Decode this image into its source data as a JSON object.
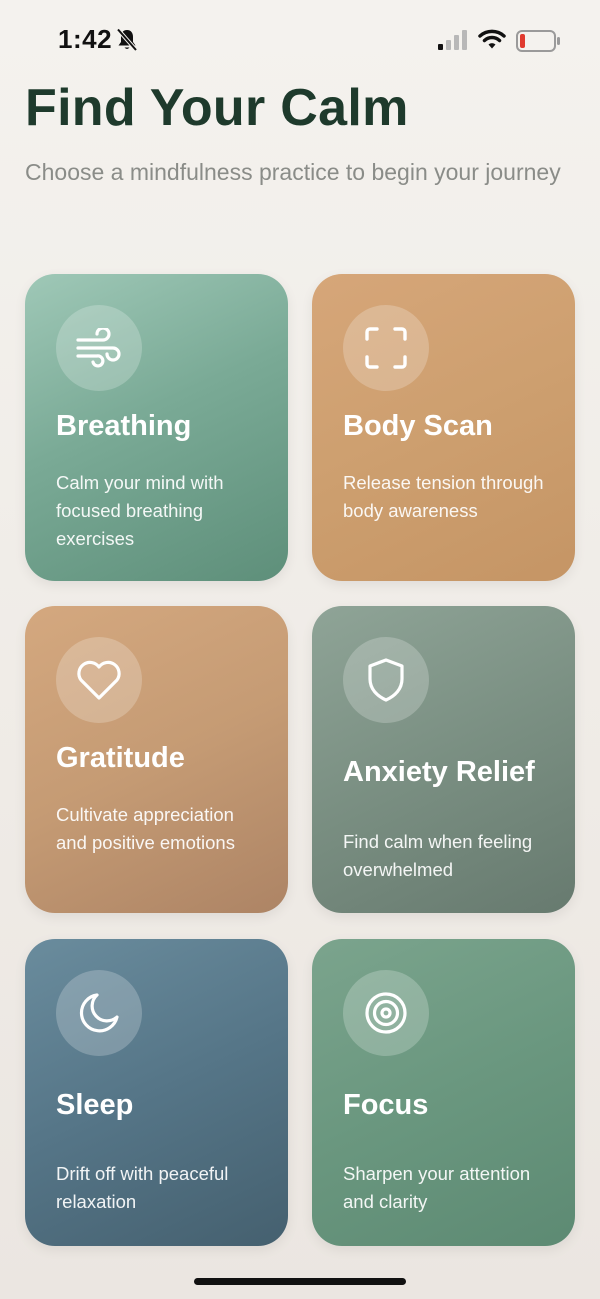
{
  "status_bar": {
    "time": "1:42"
  },
  "header": {
    "title": "Find Your Calm",
    "subtitle": "Choose a mindfulness practice to begin your journey"
  },
  "practices": [
    {
      "title": "Breathing",
      "description": "Calm your mind with focused breathing exercises",
      "icon": "wind-icon"
    },
    {
      "title": "Body Scan",
      "description": "Release tension through body awareness",
      "icon": "scan-frame-icon"
    },
    {
      "title": "Gratitude",
      "description": "Cultivate appreciation and positive emotions",
      "icon": "heart-icon"
    },
    {
      "title": "Anxiety Relief",
      "description": "Find calm when feeling overwhelmed",
      "icon": "shield-icon"
    },
    {
      "title": "Sleep",
      "description": "Drift off with peaceful relaxation",
      "icon": "moon-icon"
    },
    {
      "title": "Focus",
      "description": "Sharpen your attention and clarity",
      "icon": "target-icon"
    }
  ],
  "colors": {
    "title": "#1e3a2c",
    "subtitle": "#8a8c88",
    "breathing": "#7aaa96",
    "body_scan": "#cd9f6f",
    "gratitude": "#c59b74",
    "anxiety_relief": "#7a8f82",
    "sleep": "#557587",
    "focus": "#6a977f"
  }
}
